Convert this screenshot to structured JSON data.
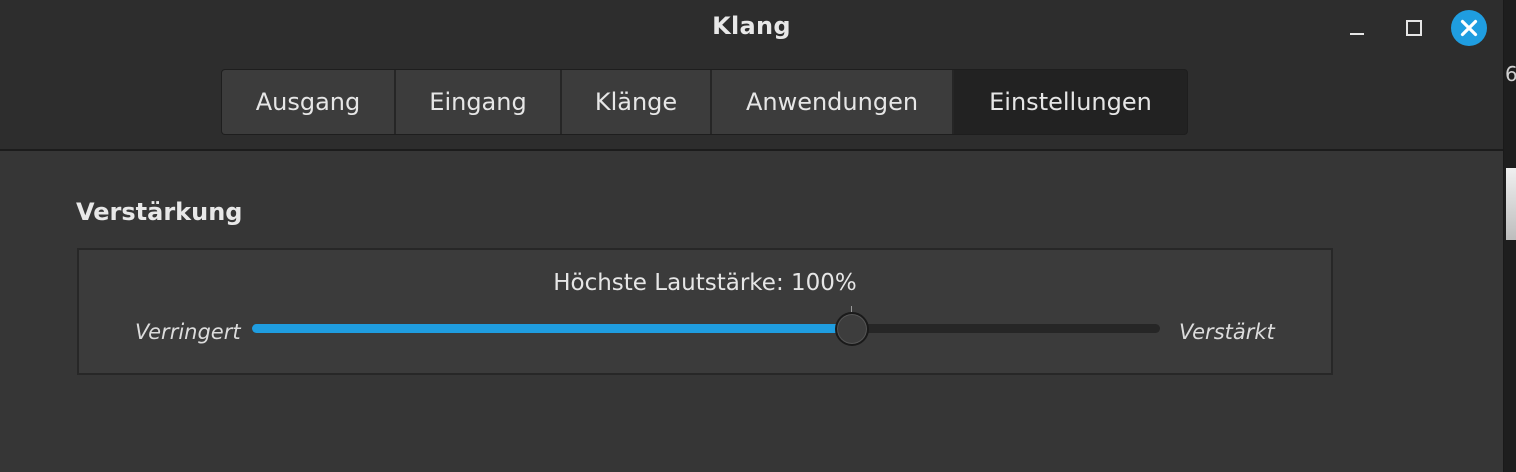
{
  "window": {
    "title": "Klang"
  },
  "window_controls": {
    "minimize_icon": "minimize-icon",
    "maximize_icon": "maximize-icon",
    "close_icon": "close-icon",
    "close_color": "#1f9de0"
  },
  "tabs": [
    {
      "label": "Ausgang",
      "active": false
    },
    {
      "label": "Eingang",
      "active": false
    },
    {
      "label": "Klänge",
      "active": false
    },
    {
      "label": "Anwendungen",
      "active": false
    },
    {
      "label": "Einstellungen",
      "active": true
    }
  ],
  "amplification": {
    "section_title": "Verstärkung",
    "max_volume_label": "Höchste Lautstärke: 100%",
    "left_label": "Verringert",
    "right_label": "Verstärkt",
    "slider_value_fraction": 0.66,
    "slider_mark_fraction": 0.66,
    "accent_color": "#1f9de0"
  },
  "side_partial_text": "6"
}
